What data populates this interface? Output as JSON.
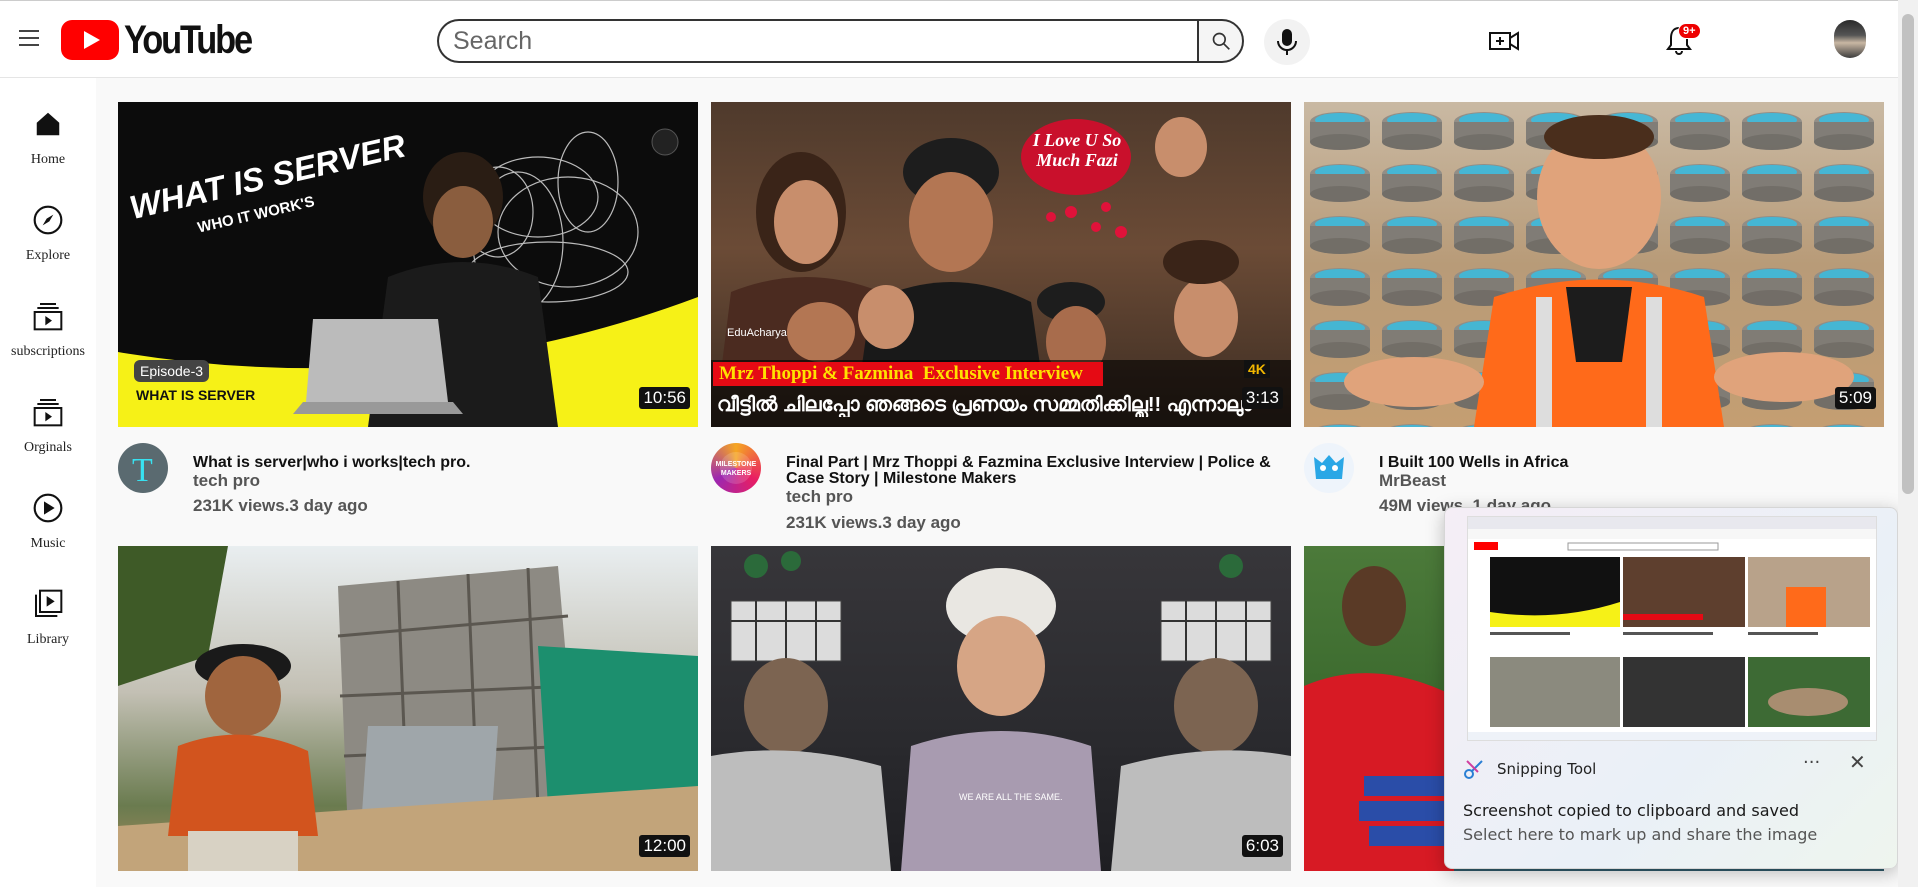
{
  "header": {
    "logo_text": "YouTube",
    "search_placeholder": "Search",
    "notification_count": "9+"
  },
  "sidebar": {
    "items": [
      {
        "label": "Home",
        "icon": "home-icon"
      },
      {
        "label": "Explore",
        "icon": "compass-icon"
      },
      {
        "label": "subscriptions",
        "icon": "subscriptions-icon"
      },
      {
        "label": "Orginals",
        "icon": "originals-icon"
      },
      {
        "label": "Music",
        "icon": "music-icon"
      },
      {
        "label": "Library",
        "icon": "library-icon"
      }
    ]
  },
  "videos": [
    {
      "title": "What is server|who i works|tech pro.",
      "channel": "tech pro",
      "meta": "231K views.3 day ago",
      "duration": "10:56",
      "thumb_text": {
        "headline": "WHAT IS SERVER",
        "sub": "WHO IT WORK'S",
        "badge": "Episode-3",
        "caption": "WHAT IS SERVER"
      }
    },
    {
      "title": "Final Part | Mrz Thoppi & Fazmina Exclusive Interview | Police &",
      "title_line2": "Case Story | Milestone Makers",
      "channel": "tech pro",
      "meta": "231K views.3 day ago",
      "duration": "3:13",
      "thumb_text": {
        "bubble": "I Love U So Much Fazi",
        "banner": "Mrz Thoppi & Fazmina  Exclusive Interview",
        "quality": "4K",
        "malayalam": "വീട്ടിൽ ചിലപ്പോ ഞങ്ങടെ പ്രണയം സമ്മതിക്കില്ല!! എന്നാലും",
        "brand": "EduAcharya"
      }
    },
    {
      "title": "I Built 100 Wells in Africa",
      "channel": "MrBeast",
      "meta": "49M views. 1 day ago",
      "duration": "5:09"
    },
    {
      "duration": "12:00"
    },
    {
      "duration": "6:03",
      "thumb_text": {
        "shirt": "WE ARE ALL THE SAME."
      }
    },
    {
      "duration": ""
    }
  ],
  "toast": {
    "app_name": "Snipping Tool",
    "more": "···",
    "close": "✕",
    "message": "Screenshot copied to clipboard and saved",
    "sub": "Select here to mark up and share the image"
  },
  "colors": {
    "brand_red": "#ff0000",
    "badge_red": "#e00000"
  }
}
